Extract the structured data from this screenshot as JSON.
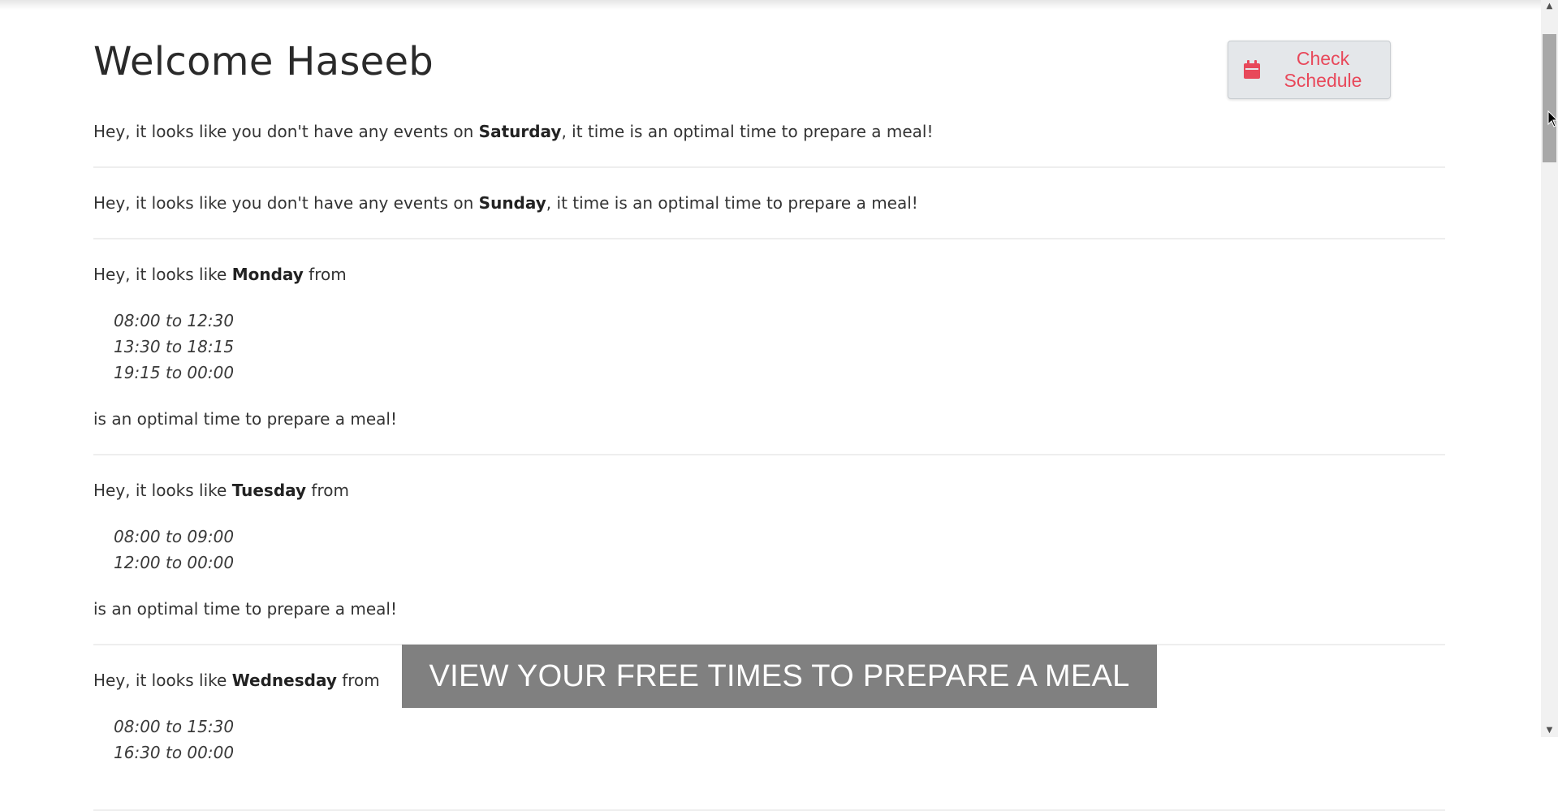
{
  "header": {
    "title": "Welcome Haseeb",
    "check_schedule_label": "Check Schedule",
    "calendar_icon": "calendar-icon"
  },
  "events": [
    {
      "type": "simple",
      "prefix": "Hey, it looks like you don't have any events on ",
      "day": "Saturday",
      "suffix": ", it time is an optimal time to prepare a meal!"
    },
    {
      "type": "simple",
      "prefix": "Hey, it looks like you don't have any events on ",
      "day": "Sunday",
      "suffix": ", it time is an optimal time to prepare a meal!"
    },
    {
      "type": "ranged",
      "prefix": "Hey, it looks like ",
      "day": "Monday",
      "suffix": " from",
      "ranges": [
        "08:00 to 12:30",
        "13:30 to 18:15",
        "19:15 to 00:00"
      ],
      "closing": "is an optimal time to prepare a meal!"
    },
    {
      "type": "ranged",
      "prefix": "Hey, it looks like ",
      "day": "Tuesday",
      "suffix": " from",
      "ranges": [
        "08:00 to 09:00",
        "12:00 to 00:00"
      ],
      "closing": "is an optimal time to prepare a meal!"
    },
    {
      "type": "ranged",
      "prefix": "Hey, it looks like ",
      "day": "Wednesday",
      "suffix": " from",
      "ranges": [
        "08:00 to 15:30",
        "16:30 to 00:00"
      ],
      "closing": ""
    }
  ],
  "caption": "VIEW YOUR FREE TIMES TO PREPARE A MEAL",
  "colors": {
    "accent": "#e8485a",
    "button_bg": "#e4e7ea",
    "caption_bg": "#6e6e6e"
  }
}
